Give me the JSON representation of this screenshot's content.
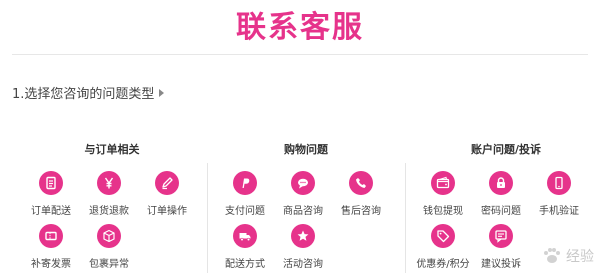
{
  "header": {
    "title": "联系客服"
  },
  "step": {
    "text": "1.选择您咨询的问题类型"
  },
  "groups": [
    {
      "title": "与订单相关",
      "items": [
        {
          "label": "订单配送",
          "icon": "doc-icon"
        },
        {
          "label": "退货退款",
          "icon": "yen-icon"
        },
        {
          "label": "订单操作",
          "icon": "pencil-icon"
        },
        {
          "label": "补寄发票",
          "icon": "ticket-icon"
        },
        {
          "label": "包裹异常",
          "icon": "box-icon"
        }
      ]
    },
    {
      "title": "购物问题",
      "items": [
        {
          "label": "支付问题",
          "icon": "paypal-icon"
        },
        {
          "label": "商品咨询",
          "icon": "chat-icon"
        },
        {
          "label": "售后咨询",
          "icon": "phone-icon"
        },
        {
          "label": "配送方式",
          "icon": "truck-icon"
        },
        {
          "label": "活动咨询",
          "icon": "star-icon"
        }
      ]
    },
    {
      "title": "账户问题/投诉",
      "items": [
        {
          "label": "钱包提现",
          "icon": "wallet-icon"
        },
        {
          "label": "密码问题",
          "icon": "lock-icon"
        },
        {
          "label": "手机验证",
          "icon": "mobile-icon"
        },
        {
          "label": "优惠券/积分",
          "icon": "tag-icon"
        },
        {
          "label": "建议投诉",
          "icon": "comment-icon"
        }
      ]
    }
  ],
  "watermark": {
    "text": "经验"
  },
  "colors": {
    "accent": "#e6338b"
  }
}
